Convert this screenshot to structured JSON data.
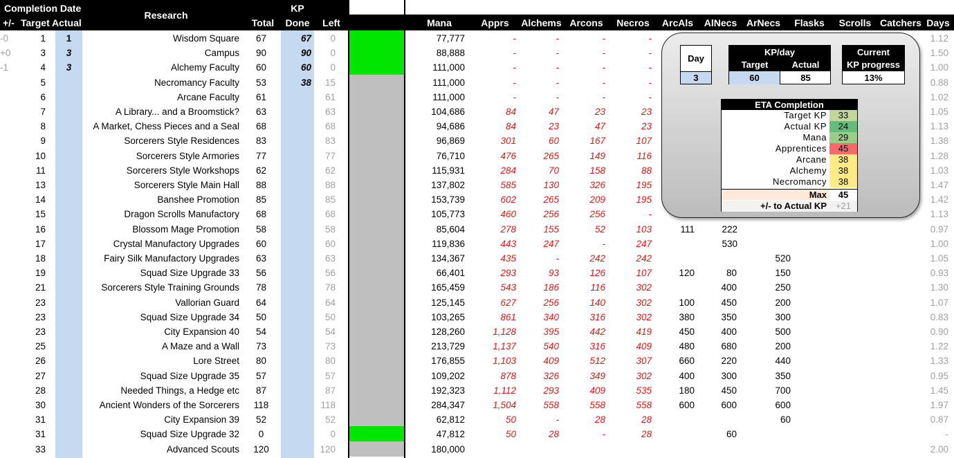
{
  "header": {
    "completion_date": "Completion Date",
    "research": "Research",
    "kp": "KP",
    "cols": {
      "diff": "+/-",
      "target": "Target",
      "actual": "Actual",
      "total": "Total",
      "done": "Done",
      "left": "Left",
      "mana": "Mana",
      "apprs": "Apprs",
      "alchems": "Alchems",
      "arcons": "Arcons",
      "necros": "Necros",
      "arcals": "ArcAls",
      "alnecs": "AlNecs",
      "arnecs": "ArNecs",
      "flasks": "Flasks",
      "scrolls": "Scrolls",
      "catchers": "Catchers",
      "days": "Days"
    }
  },
  "colors": {
    "green": "#00e600",
    "grey_bar": "#bfbfbf",
    "blue_col": "#c5d9f1",
    "red_text": "#e01818"
  },
  "rows": [
    {
      "diff": "-0",
      "target": "1",
      "actual": "1",
      "name": "Wisdom Square",
      "total": "67",
      "done": "67",
      "left": "0",
      "bar": "green",
      "mana": "77,777",
      "apprs": "-",
      "alchems": "-",
      "arcons": "-",
      "necros": "-",
      "days": "1.12"
    },
    {
      "diff": "+0",
      "target": "3",
      "actual": "3",
      "name": "Campus",
      "total": "90",
      "done": "90",
      "left": "0",
      "bar": "green",
      "mana": "88,888",
      "apprs": "-",
      "alchems": "-",
      "arcons": "-",
      "necros": "-",
      "days": "1.50"
    },
    {
      "diff": "-1",
      "target": "4",
      "actual": "3",
      "name": "Alchemy Faculty",
      "total": "60",
      "done": "60",
      "left": "0",
      "bar": "green",
      "mana": "111,000",
      "apprs": "-",
      "alchems": "-",
      "arcons": "-",
      "necros": "-",
      "days": "1.00"
    },
    {
      "diff": "",
      "target": "5",
      "actual": "",
      "name": "Necromancy Faculty",
      "total": "53",
      "done": "38",
      "left": "15",
      "bar": "grey",
      "mana": "111,000",
      "apprs": "-",
      "alchems": "-",
      "arcons": "-",
      "necros": "-",
      "days": "0.88"
    },
    {
      "diff": "",
      "target": "6",
      "actual": "",
      "name": "Arcane Faculty",
      "total": "61",
      "done": "",
      "left": "61",
      "bar": "grey",
      "mana": "111,000",
      "apprs": "-",
      "alchems": "-",
      "arcons": "-",
      "necros": "-",
      "days": "1.02"
    },
    {
      "diff": "",
      "target": "7",
      "actual": "",
      "name": "A Library... and a Broomstick?",
      "total": "63",
      "done": "",
      "left": "63",
      "bar": "grey",
      "mana": "104,686",
      "apprs": "84",
      "alchems": "47",
      "arcons": "23",
      "necros": "23",
      "days": "1.05"
    },
    {
      "diff": "",
      "target": "8",
      "actual": "",
      "name": "A Market, Chess Pieces and a Seal",
      "total": "68",
      "done": "",
      "left": "68",
      "bar": "grey",
      "mana": "94,686",
      "apprs": "84",
      "alchems": "23",
      "arcons": "47",
      "necros": "23",
      "days": "1.13"
    },
    {
      "diff": "",
      "target": "9",
      "actual": "",
      "name": "Sorcerers Style Residences",
      "total": "83",
      "done": "",
      "left": "83",
      "bar": "grey",
      "mana": "96,869",
      "apprs": "301",
      "alchems": "60",
      "arcons": "167",
      "necros": "107",
      "days": "1.38"
    },
    {
      "diff": "",
      "target": "10",
      "actual": "",
      "name": "Sorcerers Style Armories",
      "total": "77",
      "done": "",
      "left": "77",
      "bar": "grey",
      "mana": "76,710",
      "apprs": "476",
      "alchems": "265",
      "arcons": "149",
      "necros": "116",
      "days": "1.28"
    },
    {
      "diff": "",
      "target": "11",
      "actual": "",
      "name": "Sorcerers Style Workshops",
      "total": "62",
      "done": "",
      "left": "62",
      "bar": "grey",
      "mana": "115,931",
      "apprs": "284",
      "alchems": "70",
      "arcons": "158",
      "necros": "88",
      "days": "1.03"
    },
    {
      "diff": "",
      "target": "13",
      "actual": "",
      "name": "Sorcerers Style Main Hall",
      "total": "88",
      "done": "",
      "left": "88",
      "bar": "grey",
      "mana": "137,802",
      "apprs": "585",
      "alchems": "130",
      "arcons": "326",
      "necros": "195",
      "days": "1.47"
    },
    {
      "diff": "",
      "target": "14",
      "actual": "",
      "name": "Banshee Promotion",
      "total": "85",
      "done": "",
      "left": "85",
      "bar": "grey",
      "mana": "153,739",
      "apprs": "602",
      "alchems": "265",
      "arcons": "209",
      "necros": "195",
      "days": "1.42"
    },
    {
      "diff": "",
      "target": "15",
      "actual": "",
      "name": "Dragon Scrolls Manufactory",
      "total": "68",
      "done": "",
      "left": "68",
      "bar": "grey",
      "mana": "105,773",
      "apprs": "460",
      "alchems": "256",
      "arcons": "256",
      "necros": "-",
      "days": "1.13"
    },
    {
      "diff": "",
      "target": "16",
      "actual": "",
      "name": "Blossom Mage Promotion",
      "total": "58",
      "done": "",
      "left": "58",
      "bar": "grey",
      "mana": "85,604",
      "apprs": "278",
      "alchems": "155",
      "arcons": "52",
      "necros": "103",
      "arcals": "111",
      "alnecs": "222",
      "days": "0.97"
    },
    {
      "diff": "",
      "target": "17",
      "actual": "",
      "name": "Crystal Manufactory Upgrades",
      "total": "60",
      "done": "",
      "left": "60",
      "bar": "grey",
      "mana": "119,836",
      "apprs": "443",
      "alchems": "247",
      "arcons": "-",
      "necros": "247",
      "alnecs": "530",
      "days": "1.00"
    },
    {
      "diff": "",
      "target": "18",
      "actual": "",
      "name": "Fairy Silk Manufactory Upgrades",
      "total": "63",
      "done": "",
      "left": "63",
      "bar": "grey",
      "mana": "134,367",
      "apprs": "435",
      "alchems": "-",
      "arcons": "242",
      "necros": "242",
      "flasks": "520",
      "days": "1.05"
    },
    {
      "diff": "",
      "target": "19",
      "actual": "",
      "name": "Squad Size Upgrade 33",
      "total": "56",
      "done": "",
      "left": "56",
      "bar": "grey",
      "mana": "66,401",
      "apprs": "293",
      "alchems": "93",
      "arcons": "126",
      "necros": "107",
      "arcals": "120",
      "arnecs": "80",
      "flasks": "150",
      "days": "0.93"
    },
    {
      "diff": "",
      "target": "21",
      "actual": "",
      "name": "Sorcerers Style Training Grounds",
      "total": "78",
      "done": "",
      "left": "78",
      "bar": "grey",
      "mana": "165,459",
      "apprs": "543",
      "alchems": "186",
      "arcons": "116",
      "necros": "302",
      "arnecs": "400",
      "flasks": "250",
      "days": "1.30"
    },
    {
      "diff": "",
      "target": "23",
      "actual": "",
      "name": "Vallorian Guard",
      "total": "64",
      "done": "",
      "left": "64",
      "bar": "grey",
      "mana": "125,145",
      "apprs": "627",
      "alchems": "256",
      "arcons": "140",
      "necros": "302",
      "arcals": "100",
      "arnecs": "450",
      "flasks": "200",
      "days": "1.07"
    },
    {
      "diff": "",
      "target": "23",
      "actual": "",
      "name": "Squad Size Upgrade 34",
      "total": "50",
      "done": "",
      "left": "50",
      "bar": "grey",
      "mana": "103,265",
      "apprs": "861",
      "alchems": "340",
      "arcons": "316",
      "necros": "302",
      "arcals": "380",
      "arnecs": "350",
      "flasks": "300",
      "days": "0.83"
    },
    {
      "diff": "",
      "target": "23",
      "actual": "",
      "name": "City Expansion 40",
      "total": "54",
      "done": "",
      "left": "54",
      "bar": "grey",
      "mana": "128,260",
      "apprs": "1,128",
      "alchems": "395",
      "arcons": "442",
      "necros": "419",
      "arcals": "450",
      "arnecs": "400",
      "flasks": "500",
      "days": "0.90"
    },
    {
      "diff": "",
      "target": "25",
      "actual": "",
      "name": "A Maze and a Wall",
      "total": "73",
      "done": "",
      "left": "73",
      "bar": "grey",
      "mana": "213,729",
      "apprs": "1,137",
      "alchems": "540",
      "arcons": "316",
      "necros": "409",
      "arcals": "480",
      "arnecs": "680",
      "flasks": "200",
      "days": "1.22"
    },
    {
      "diff": "",
      "target": "26",
      "actual": "",
      "name": "Lore Street",
      "total": "80",
      "done": "",
      "left": "80",
      "bar": "grey",
      "mana": "176,855",
      "apprs": "1,103",
      "alchems": "409",
      "arcons": "512",
      "necros": "307",
      "arcals": "660",
      "arnecs": "220",
      "flasks": "440",
      "days": "1.33"
    },
    {
      "diff": "",
      "target": "27",
      "actual": "",
      "name": "Squad Size Upgrade 35",
      "total": "57",
      "done": "",
      "left": "57",
      "bar": "grey",
      "mana": "109,202",
      "apprs": "878",
      "alchems": "326",
      "arcons": "349",
      "necros": "302",
      "arcals": "400",
      "arnecs": "300",
      "flasks": "350",
      "days": "0.95"
    },
    {
      "diff": "",
      "target": "28",
      "actual": "",
      "name": "Needed Things, a Hedge etc",
      "total": "87",
      "done": "",
      "left": "87",
      "bar": "grey",
      "mana": "192,323",
      "apprs": "1,112",
      "alchems": "293",
      "arcons": "409",
      "necros": "535",
      "arcals": "180",
      "arnecs": "450",
      "flasks": "700",
      "days": "1.45"
    },
    {
      "diff": "",
      "target": "30",
      "actual": "",
      "name": "Ancient Wonders of the Sorcerers",
      "total": "118",
      "done": "",
      "left": "118",
      "bar": "grey",
      "mana": "284,347",
      "apprs": "1,504",
      "alchems": "558",
      "arcons": "558",
      "necros": "558",
      "arcals": "600",
      "arnecs": "600",
      "flasks": "600",
      "days": "1.97"
    },
    {
      "diff": "",
      "target": "31",
      "actual": "",
      "name": "City Expansion 39",
      "total": "52",
      "done": "",
      "left": "52",
      "bar": "grey",
      "mana": "62,812",
      "apprs": "50",
      "alchems": "-",
      "arcons": "28",
      "necros": "28",
      "flasks": "60",
      "days": "0.87"
    },
    {
      "diff": "",
      "target": "31",
      "actual": "",
      "name": "Squad Size Upgrade 32",
      "total": "0",
      "done": "",
      "left": "0",
      "bar": "green",
      "mana": "47,812",
      "apprs": "50",
      "alchems": "28",
      "arcons": "-",
      "necros": "28",
      "arnecs": "60",
      "days": "-"
    },
    {
      "diff": "",
      "target": "33",
      "actual": "",
      "name": "Advanced Scouts",
      "total": "120",
      "done": "",
      "left": "120",
      "bar": "grey",
      "mana": "180,000",
      "days": "2.00"
    }
  ],
  "panel": {
    "day_label": "Day",
    "day_value": "3",
    "kpday_title": "KP/day",
    "kpday_target_label": "Target",
    "kpday_actual_label": "Actual",
    "kpday_target": "60",
    "kpday_actual": "85",
    "current_title1": "Current",
    "current_title2": "KP progress",
    "current_value": "13%",
    "eta_title": "ETA Completion",
    "eta": [
      {
        "label": "Target KP",
        "value": "33",
        "color": "#c4d79b"
      },
      {
        "label": "Actual KP",
        "value": "24",
        "color": "#63be7b"
      },
      {
        "label": "Mana",
        "value": "29",
        "color": "#9ccc8a"
      },
      {
        "label": "Apprentices",
        "value": "45",
        "color": "#f8696b"
      },
      {
        "label": "Arcane",
        "value": "38",
        "color": "#ffeb84"
      },
      {
        "label": "Alchemy",
        "value": "38",
        "color": "#ffeb84"
      },
      {
        "label": "Necromancy",
        "value": "38",
        "color": "#ffeb84"
      }
    ],
    "max_label": "Max",
    "max_value": "45",
    "diff_label": "+/- to Actual KP",
    "diff_value": "+21"
  }
}
